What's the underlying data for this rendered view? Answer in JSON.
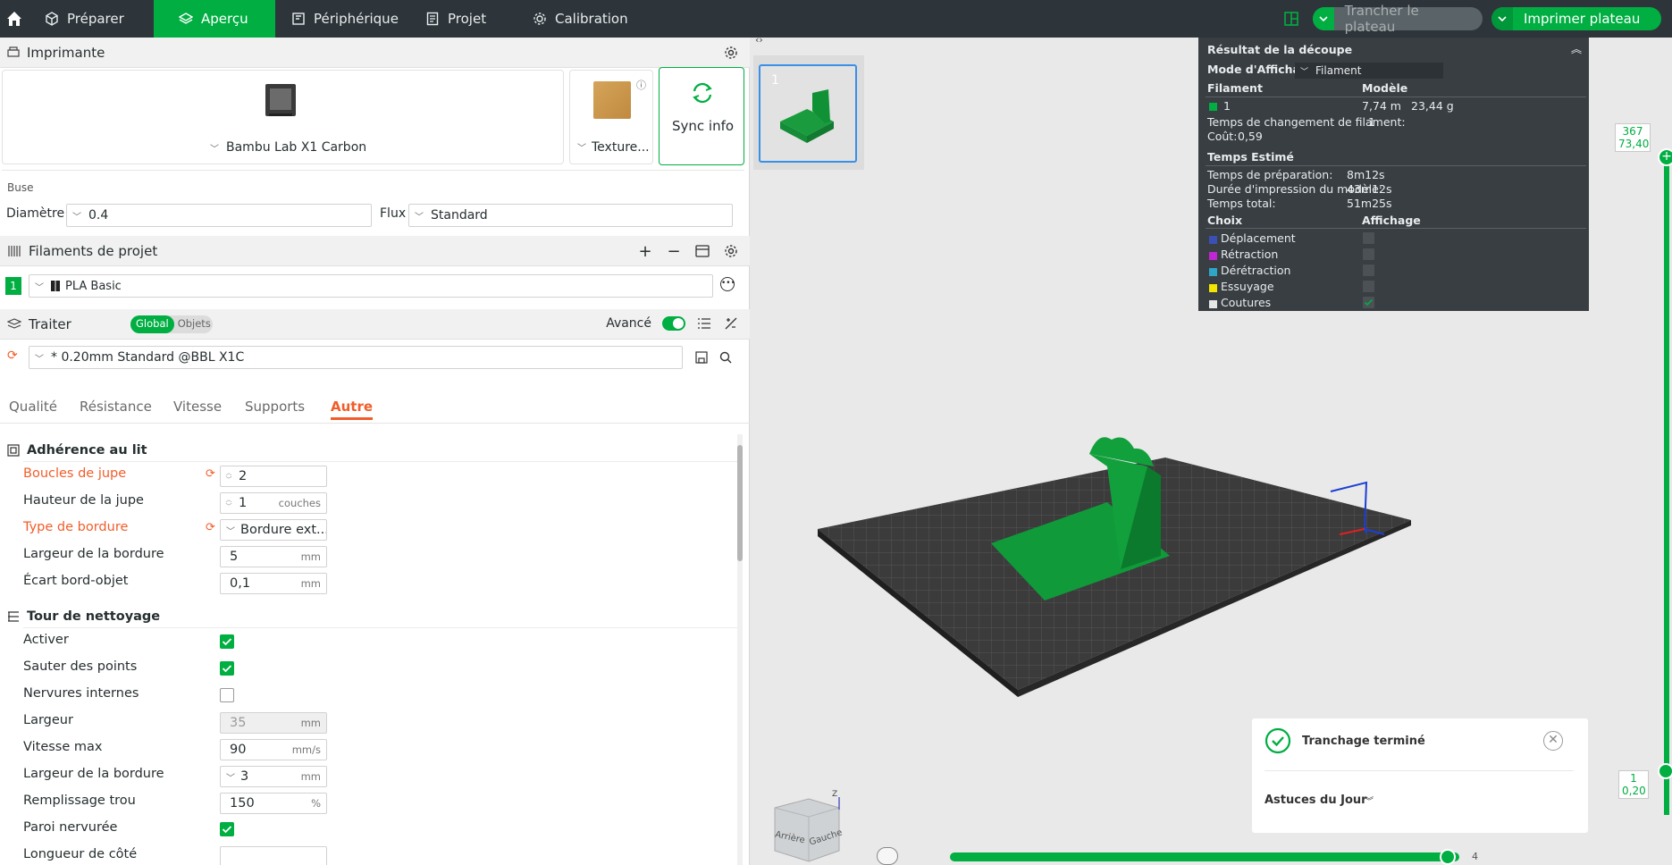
{
  "topbar": {
    "tabs": [
      {
        "label": "Préparer"
      },
      {
        "label": "Aperçu"
      },
      {
        "label": "Périphérique"
      },
      {
        "label": "Projet"
      },
      {
        "label": "Calibration"
      }
    ],
    "slice_label": "Trancher le plateau",
    "print_label": "Imprimer plateau"
  },
  "printer": {
    "title": "Imprimante",
    "name": "Bambu Lab X1 Carbon",
    "plate": "Texture...",
    "sync": "Sync info",
    "nozzle_title": "Buse",
    "diameter_label": "Diamètre",
    "diameter_value": "0.4",
    "flow_label": "Flux",
    "flow_value": "Standard"
  },
  "filaments": {
    "title": "Filaments de projet",
    "items": [
      {
        "index": "1",
        "name": "PLA Basic",
        "color": "#00ae42"
      }
    ]
  },
  "process": {
    "title": "Traiter",
    "toggle_global": "Global",
    "toggle_objects": "Objets",
    "advanced": "Avancé",
    "preset": "* 0.20mm Standard @BBL X1C",
    "tabs": [
      {
        "label": "Qualité"
      },
      {
        "label": "Résistance"
      },
      {
        "label": "Vitesse"
      },
      {
        "label": "Supports"
      },
      {
        "label": "Autre"
      }
    ],
    "group1": "Adhérence au lit",
    "group2": "Tour de nettoyage",
    "rows": {
      "skirt_loops": {
        "label": "Boucles de jupe",
        "value": "2"
      },
      "skirt_height": {
        "label": "Hauteur de la jupe",
        "value": "1",
        "unit": "couches"
      },
      "brim_type": {
        "label": "Type de bordure",
        "value": "Bordure ext..."
      },
      "brim_width": {
        "label": "Largeur de la bordure",
        "value": "5",
        "unit": "mm"
      },
      "brim_gap": {
        "label": "Écart bord-objet",
        "value": "0,1",
        "unit": "mm"
      },
      "enable": {
        "label": "Activer"
      },
      "skip_points": {
        "label": "Sauter des points"
      },
      "inner_ribs": {
        "label": "Nervures internes"
      },
      "width": {
        "label": "Largeur",
        "value": "35",
        "unit": "mm"
      },
      "max_speed": {
        "label": "Vitesse max",
        "value": "90",
        "unit": "mm/s"
      },
      "prime_brim": {
        "label": "Largeur de la bordure",
        "value": "3",
        "unit": "mm"
      },
      "infill_gap": {
        "label": "Remplissage trou",
        "value": "150",
        "unit": "%"
      },
      "rib_wall": {
        "label": "Paroi nervurée"
      },
      "side_length": {
        "label": "Longueur de côté"
      }
    }
  },
  "preview": {
    "plate_number": "1",
    "result": {
      "title": "Résultat de la découpe",
      "mode_label": "Mode d'Affichage",
      "mode_value": "Filament",
      "col_filament": "Filament",
      "col_model": "Modèle",
      "fil_index": "1",
      "fil_length": "7,74 m",
      "fil_weight": "23,44 g",
      "change_time_label": "Temps de changement de filament:",
      "change_time_value": "1",
      "cost_label": "Coût:",
      "cost_value": "0,59",
      "est_title": "Temps Estimé",
      "prep_label": "Temps de préparation:",
      "prep_value": "8m12s",
      "print_label": "Durée d'impression du modèle:",
      "print_value": "43m12s",
      "total_label": "Temps total:",
      "total_value": "51m25s",
      "choice_col": "Choix",
      "display_col": "Affichage",
      "legend": [
        {
          "label": "Déplacement",
          "color": "#3b4fb5"
        },
        {
          "label": "Rétraction",
          "color": "#c026d3"
        },
        {
          "label": "Dérétraction",
          "color": "#2ea6c8"
        },
        {
          "label": "Essuyage",
          "color": "#f2e600"
        },
        {
          "label": "Coutures",
          "color": "#e6e6e6"
        }
      ]
    },
    "layer_top": "367",
    "layer_top_h": "73,40",
    "layer_bottom": "1",
    "layer_bottom_h": "0,20",
    "move_index": "4",
    "toast_title": "Tranchage terminé",
    "toast_tips": "Astuces du Jour",
    "cube_back": "Arrière",
    "cube_left": "Gauche",
    "axis_z": "Z"
  }
}
